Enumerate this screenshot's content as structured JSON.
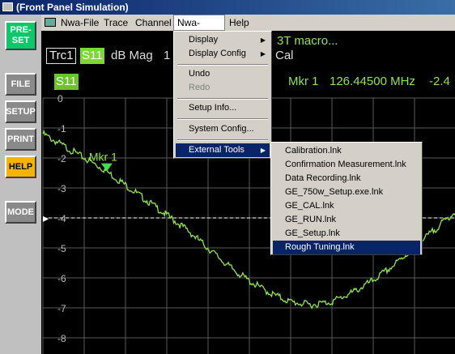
{
  "window": {
    "title": "(Front Panel Simulation)"
  },
  "side_buttons": [
    {
      "label": "PRE-SET",
      "color": "#0cc86a"
    },
    {
      "label": "FILE",
      "color": "#8a8a8a"
    },
    {
      "label": "SETUP",
      "color": "#8a8a8a"
    },
    {
      "label": "PRINT",
      "color": "#8a8a8a"
    },
    {
      "label": "HELP",
      "color": "#f4b400"
    },
    {
      "label": "MODE",
      "color": "#8a8a8a"
    }
  ],
  "menubar": {
    "items": [
      "Nwa-File",
      "Trace",
      "Channel",
      "Nwa-Setup",
      "Help"
    ],
    "active": "Nwa-Setup"
  },
  "trace_header": {
    "trace": "Trc1",
    "param": "S11",
    "format": "dB Mag",
    "scale_partial": "1",
    "title_partial": "3T macro...",
    "cal": "Cal"
  },
  "marker_readout": {
    "label": "Mkr 1",
    "freq": "126.44500 MHz",
    "value_partial": "-2.4"
  },
  "plot_tag": "S11",
  "marker_label": "Mkr 1",
  "y_ticks": [
    "0",
    "-1",
    "-2",
    "-3",
    "-4",
    "-5",
    "-6",
    "-7",
    "-8"
  ],
  "reference_value": -4,
  "trace_curve": {
    "x": [
      0,
      0.05,
      0.1,
      0.15,
      0.2,
      0.25,
      0.3,
      0.35,
      0.4,
      0.45,
      0.5,
      0.55,
      0.6,
      0.65,
      0.7,
      0.75,
      0.8,
      0.85,
      0.9,
      0.95,
      1.0
    ],
    "y": [
      -1.2,
      -1.6,
      -2.0,
      -2.4,
      -2.9,
      -3.4,
      -3.9,
      -4.4,
      -5.0,
      -5.6,
      -6.1,
      -6.5,
      -6.8,
      -6.9,
      -6.8,
      -6.5,
      -6.1,
      -5.6,
      -5.0,
      -4.4,
      -3.8
    ]
  },
  "marker_x": 0.155,
  "nwa_setup_menu": [
    {
      "label": "Display",
      "submenu": true,
      "disabled": false
    },
    {
      "label": "Display Config",
      "submenu": true,
      "disabled": false
    },
    {
      "separator": true
    },
    {
      "label": "Undo",
      "submenu": false,
      "disabled": false
    },
    {
      "label": "Redo",
      "submenu": false,
      "disabled": true
    },
    {
      "separator": true
    },
    {
      "label": "Setup Info...",
      "submenu": false,
      "disabled": false
    },
    {
      "separator": true
    },
    {
      "label": "System Config...",
      "submenu": false,
      "disabled": false
    },
    {
      "separator": true
    },
    {
      "label": "External Tools",
      "submenu": true,
      "disabled": false,
      "highlighted": true
    }
  ],
  "external_tools_menu": [
    "Calibration.lnk",
    "Confirmation Measurement.lnk",
    "Data Recording.lnk",
    "GE_750w_Setup.exe.lnk",
    "GE_CAL.lnk",
    "GE_RUN.lnk",
    "GE_Setup.lnk",
    "Rough Tuning.lnk"
  ],
  "external_tools_highlighted": "Rough Tuning.lnk",
  "colors": {
    "trace": "#8ee64a",
    "grid": "#5a5a5a",
    "highlight": "#0a246a"
  }
}
